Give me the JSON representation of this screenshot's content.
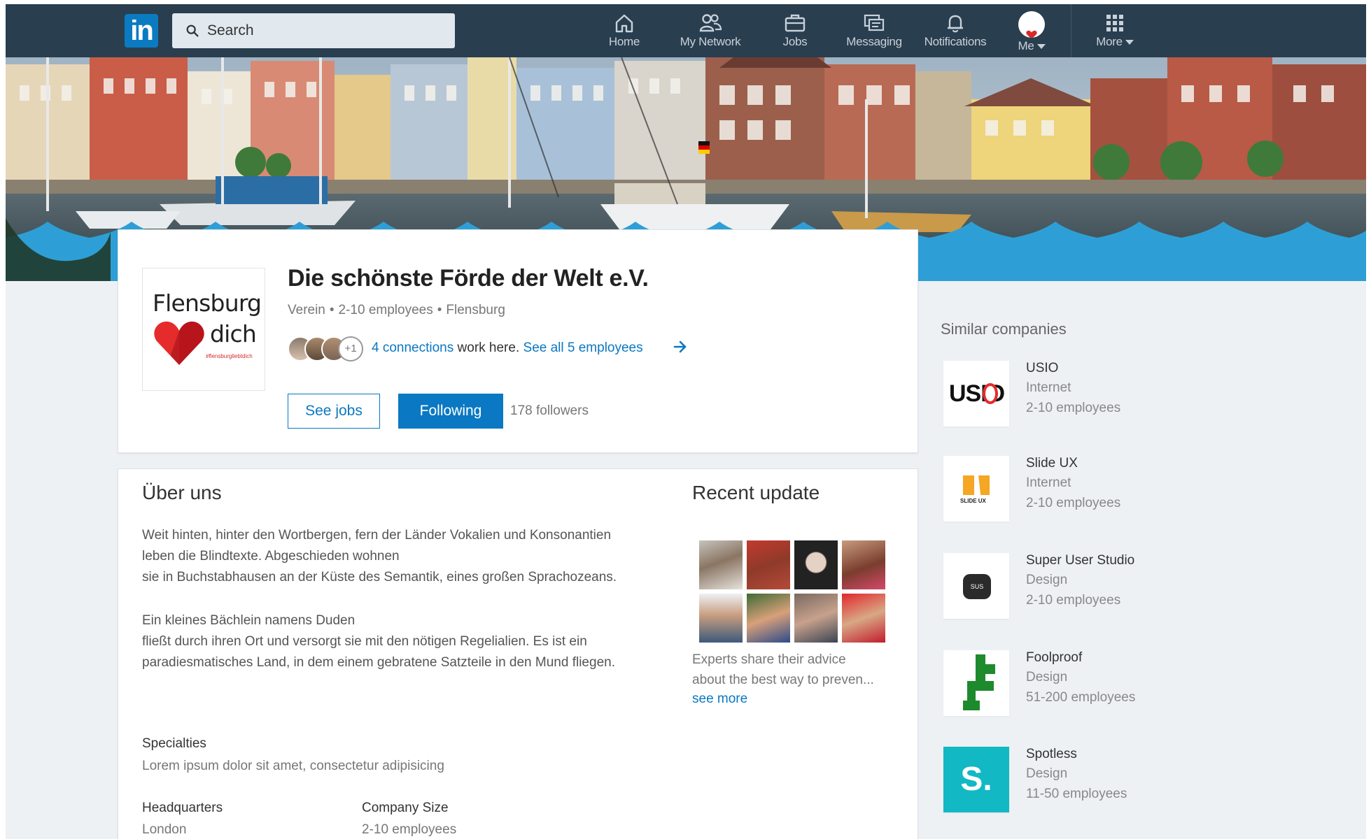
{
  "nav": {
    "search_placeholder": "Search",
    "items": [
      {
        "label": "Home",
        "icon": "home-icon"
      },
      {
        "label": "My Network",
        "icon": "network-icon"
      },
      {
        "label": "Jobs",
        "icon": "briefcase-icon"
      },
      {
        "label": "Messaging",
        "icon": "messaging-icon"
      },
      {
        "label": "Notifications",
        "icon": "bell-icon"
      },
      {
        "label": "Me",
        "icon": "avatar"
      },
      {
        "label": "More",
        "icon": "grid-icon"
      }
    ]
  },
  "company": {
    "name": "Die schönste Förde der Welt e.V.",
    "type": "Verein",
    "size": "2-10 employees",
    "location": "Flensburg",
    "logo_text_1": "Flensburg",
    "logo_text_2": "dich",
    "logo_tag": "#flensburgliebtdich",
    "connections_more": "+1",
    "connections_link": "4 connections",
    "connections_suffix": "work here.",
    "see_all_link": "See all 5 employees",
    "see_jobs_label": "See jobs",
    "following_label": "Following",
    "followers": "178 followers"
  },
  "about": {
    "title": "Über uns",
    "paragraph1_line1": "Weit hinten, hinter den Wortbergen, fern der Länder Vokalien und Konsonantien",
    "paragraph1_line2": "leben die Blindtexte. Abgeschieden wohnen",
    "paragraph1_line3": "sie in Buchstabhausen an der Küste des Semantik, eines großen Sprachozeans.",
    "paragraph2_line1": "Ein kleines Bächlein namens Duden",
    "paragraph2_line2": "fließt durch ihren Ort und versorgt sie mit den nötigen Regelialien. Es ist ein",
    "paragraph2_line3": "paradiesmatisches Land, in dem einem gebratene Satzteile in den Mund fliegen.",
    "specialties_label": "Specialties",
    "specialties_value": "Lorem ipsum dolor sit amet, consectetur adipisicing",
    "hq_label": "Headquarters",
    "hq_value": "London",
    "company_size_label": "Company Size",
    "company_size_value": "2-10 employees"
  },
  "recent": {
    "title": "Recent update",
    "text_line1": "Experts share their advice",
    "text_line2": "about the best way to preven...",
    "see_more": "see more"
  },
  "similar": {
    "title": "Similar companies",
    "items": [
      {
        "name": "USIO",
        "industry": "Internet",
        "size": "2-10 employees",
        "logo_text": "USIO"
      },
      {
        "name": "Slide UX",
        "industry": "Internet",
        "size": "2-10 employees",
        "logo_text": "SLIDE UX"
      },
      {
        "name": "Super User Studio",
        "industry": "Design",
        "size": "2-10 employees",
        "logo_text": "SUS"
      },
      {
        "name": "Foolproof",
        "industry": "Design",
        "size": "51-200 employees",
        "logo_text": ""
      },
      {
        "name": "Spotless",
        "industry": "Design",
        "size": "11-50 employees",
        "logo_text": "S."
      }
    ]
  },
  "colors": {
    "nav_bg": "#293e4f",
    "brand_blue": "#0a78c2",
    "wave_blue": "#2e9fd6",
    "page_bg": "#eef1f4",
    "spotless_teal": "#12b8c4",
    "foolproof_green": "#1e8a2e"
  }
}
